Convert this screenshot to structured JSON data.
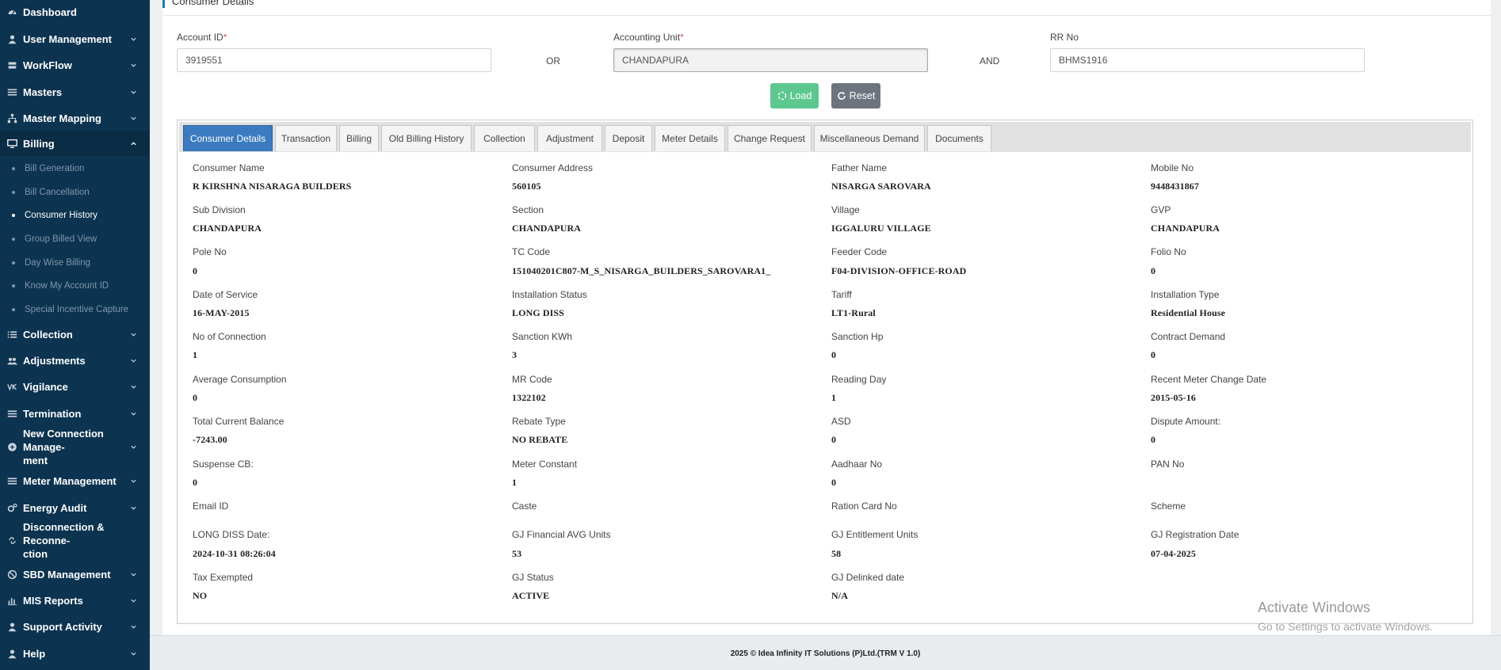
{
  "sidebar": {
    "items": [
      {
        "label": "Dashboard"
      },
      {
        "label": "User Management"
      },
      {
        "label": "WorkFlow"
      },
      {
        "label": "Masters"
      },
      {
        "label": "Master Mapping"
      },
      {
        "label": "Billing"
      },
      {
        "label": "Collection"
      },
      {
        "label": "Adjustments"
      },
      {
        "label": "Vigilance"
      },
      {
        "label": "Termination"
      },
      {
        "label": "New Connection Manage-",
        "label2": "ment"
      },
      {
        "label": "Meter Management"
      },
      {
        "label": "Energy Audit"
      },
      {
        "label": "Disconnection & Reconne-",
        "label2": "ction"
      },
      {
        "label": "SBD Management"
      },
      {
        "label": "MIS Reports"
      },
      {
        "label": "Support Activity"
      },
      {
        "label": "Help"
      }
    ],
    "billing_sub": [
      {
        "label": "Bill Generation"
      },
      {
        "label": "Bill Cancellation"
      },
      {
        "label": "Consumer History"
      },
      {
        "label": "Group Billed View"
      },
      {
        "label": "Day Wise Billing"
      },
      {
        "label": "Know My Account ID"
      },
      {
        "label": "Special Incentive Capture"
      }
    ]
  },
  "header": {
    "title": "Consumer Details"
  },
  "form": {
    "account_id_label": "Account ID",
    "account_id_value": "3919551",
    "or_text": "OR",
    "accounting_unit_label": "Accounting Unit",
    "accounting_unit_value": "CHANDAPURA",
    "and_text": "AND",
    "rr_no_label": "RR No",
    "rr_no_value": "BHMS1916",
    "required_mark": "*",
    "load_label": "Load",
    "reset_label": "Reset"
  },
  "tabs": [
    {
      "label": "Consumer Details"
    },
    {
      "label": "Transaction"
    },
    {
      "label": "Billing"
    },
    {
      "label": "Old Billing History"
    },
    {
      "label": "Collection"
    },
    {
      "label": "Adjustment"
    },
    {
      "label": "Deposit"
    },
    {
      "label": "Meter Details"
    },
    {
      "label": "Change Request"
    },
    {
      "label": "Miscellaneous Demand"
    },
    {
      "label": "Documents"
    }
  ],
  "details": [
    [
      {
        "label": "Consumer Name",
        "value": "R KIRSHNA NISARAGA BUILDERS"
      },
      {
        "label": "Consumer Address",
        "value": "560105"
      },
      {
        "label": "Father Name",
        "value": "NISARGA SAROVARA"
      },
      {
        "label": "Mobile No",
        "value": "9448431867"
      }
    ],
    [
      {
        "label": "Sub Division",
        "value": "CHANDAPURA"
      },
      {
        "label": "Section",
        "value": "CHANDAPURA"
      },
      {
        "label": "Village",
        "value": "IGGALURU VILLAGE"
      },
      {
        "label": "GVP",
        "value": "CHANDAPURA"
      }
    ],
    [
      {
        "label": "Pole No",
        "value": "0"
      },
      {
        "label": "TC Code",
        "value": "151040201C807-M_S_NISARGA_BUILDERS_SAROVARA1_"
      },
      {
        "label": "Feeder Code",
        "value": "F04-DIVISION-OFFICE-ROAD"
      },
      {
        "label": "Folio No",
        "value": "0"
      }
    ],
    [
      {
        "label": "Date of Service",
        "value": "16-MAY-2015"
      },
      {
        "label": "Installation Status",
        "value": "LONG DISS"
      },
      {
        "label": "Tariff",
        "value": "LT1-Rural"
      },
      {
        "label": "Installation Type",
        "value": "Residential House"
      }
    ],
    [
      {
        "label": "No of Connection",
        "value": "1"
      },
      {
        "label": "Sanction KWh",
        "value": "3"
      },
      {
        "label": "Sanction Hp",
        "value": "0"
      },
      {
        "label": "Contract Demand",
        "value": "0"
      }
    ],
    [
      {
        "label": "Average Consumption",
        "value": "0"
      },
      {
        "label": "MR Code",
        "value": "1322102"
      },
      {
        "label": "Reading Day",
        "value": "1"
      },
      {
        "label": "Recent Meter Change Date",
        "value": "2015-05-16"
      }
    ],
    [
      {
        "label": "Total Current Balance",
        "value": "-7243.00"
      },
      {
        "label": "Rebate Type",
        "value": "NO REBATE"
      },
      {
        "label": "ASD",
        "value": "0"
      },
      {
        "label": "Dispute Amount:",
        "value": "0"
      }
    ],
    [
      {
        "label": "Suspense CB:",
        "value": "0"
      },
      {
        "label": "Meter Constant",
        "value": "1"
      },
      {
        "label": "Aadhaar No",
        "value": "0"
      },
      {
        "label": "PAN No",
        "value": ""
      }
    ],
    [
      {
        "label": "Email ID",
        "value": ""
      },
      {
        "label": "Caste",
        "value": ""
      },
      {
        "label": "Ration Card No",
        "value": ""
      },
      {
        "label": "Scheme",
        "value": ""
      }
    ],
    [
      {
        "label": "LONG DISS Date:",
        "value": "2024-10-31 08:26:04"
      },
      {
        "label": "GJ Financial AVG Units",
        "value": "53"
      },
      {
        "label": "GJ Entitlement Units",
        "value": "58"
      },
      {
        "label": "GJ Registration Date",
        "value": "07-04-2025"
      }
    ],
    [
      {
        "label": "Tax Exempted",
        "value": "NO"
      },
      {
        "label": "GJ Status",
        "value": "ACTIVE"
      },
      {
        "label": "GJ Delinked date",
        "value": "N/A"
      }
    ]
  ],
  "footer": {
    "text": "2025 © Idea Infinity IT Solutions (P)Ltd.(TRM V 1.0)"
  },
  "watermark": {
    "line1": "Activate Windows",
    "line2": "Go to Settings to activate Windows."
  },
  "colors": {
    "sidebar": "#0c3350",
    "active_tab": "#3b7bc0",
    "load_button": "#5cc88f",
    "reset_button": "#6c757d",
    "required": "#d9534f"
  }
}
